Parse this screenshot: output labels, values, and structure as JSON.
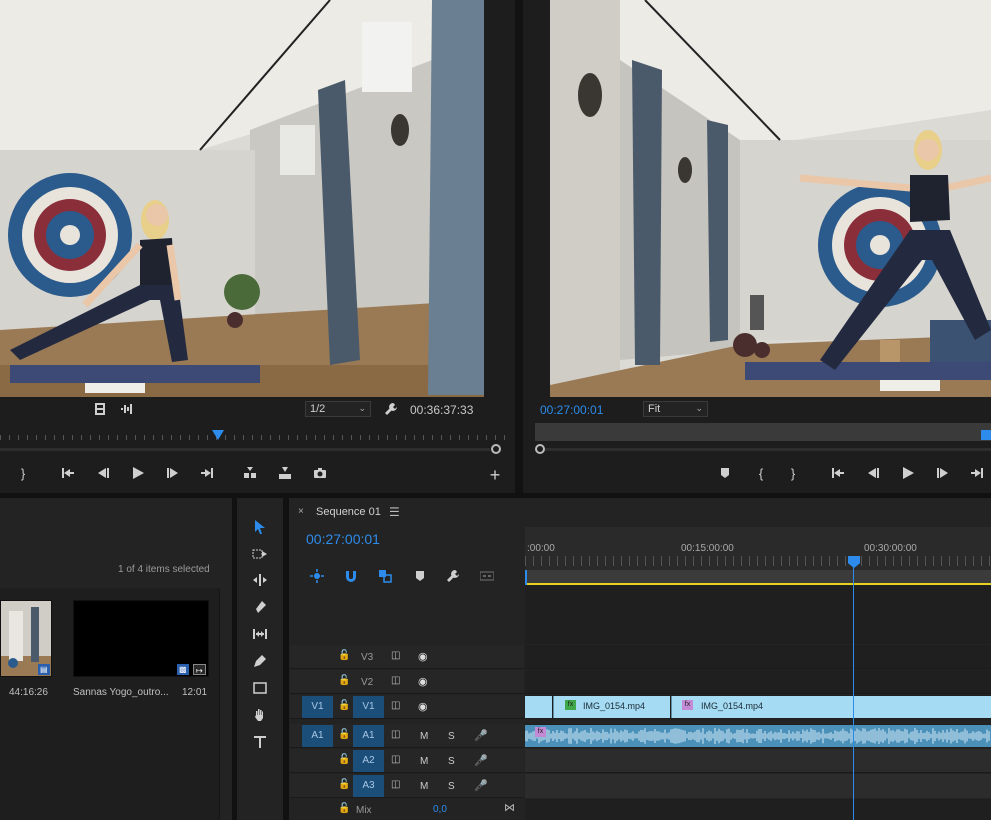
{
  "source_monitor": {
    "zoom": "1/2",
    "timecode": "00:36:37:33",
    "playhead_position": 0.48
  },
  "program_monitor": {
    "timecode": "00:27:00:01",
    "fit": "Fit"
  },
  "project": {
    "selection_status": "1 of 4 items selected",
    "items": [
      {
        "name": "",
        "duration": "44:16:26"
      },
      {
        "name": "Sannas Yogo_outro...",
        "duration": "12:01"
      }
    ]
  },
  "timeline": {
    "tab_title": "Sequence 01",
    "timecode": "00:27:00:01",
    "ruler_labels": [
      ":00:00",
      "00:15:00:00",
      "00:30:00:00"
    ],
    "tracks": {
      "v3": "V3",
      "v2": "V2",
      "v1": "V1",
      "v1_source": "V1",
      "a1": "A1",
      "a1_source": "A1",
      "a2": "A2",
      "a3": "A3",
      "mute": "M",
      "solo": "S",
      "mix_label": "Mix",
      "mix_value": "0,0"
    },
    "clips": [
      {
        "name": "IMG_0154.mp4",
        "fx": "fx"
      },
      {
        "name": "IMG_0154.mp4",
        "fx": "fx"
      }
    ],
    "audio_fx": "fx"
  },
  "colors": {
    "accent": "#2d8ceb",
    "video_clip": "#a5dcf3",
    "audio_clip": "#4a90b8",
    "track_target": "#1b4f7a",
    "work_area": "#e6d11f"
  }
}
